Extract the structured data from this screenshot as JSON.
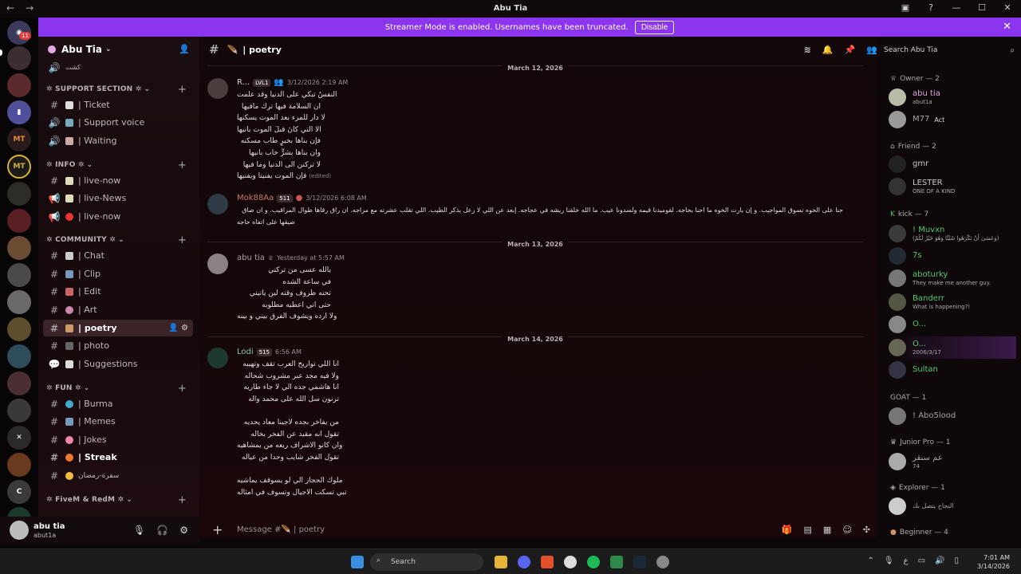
{
  "window": {
    "title": "Abu Tia",
    "back": "←",
    "forward": "→"
  },
  "banner": {
    "text": "Streamer Mode is enabled. Usernames have been truncated.",
    "button": "Disable"
  },
  "rail": {
    "badge": "11",
    "server_labels": [
      "MT",
      "C"
    ]
  },
  "guild": {
    "name": "Abu Tia"
  },
  "sidebar": {
    "top_channel": "كشت",
    "categories": [
      {
        "label": "✲ SUPPORT SECTION ✲",
        "channels": [
          "| Ticket",
          "| Support voice",
          "| Waiting"
        ]
      },
      {
        "label": "✲ INFO ✲",
        "channels": [
          "| live-now",
          "| live-News",
          "| live-now"
        ]
      },
      {
        "label": "✲ COMMUNITY ✲",
        "channels": [
          "| Chat",
          "| Clip",
          "| Edit",
          "| Art",
          "| poetry",
          "| photo",
          "| Suggestions"
        ]
      },
      {
        "label": "✲ FUN ✲",
        "channels": [
          "| Burma",
          "| Memes",
          "| Jokes",
          "| Streak",
          "سفرة-رمضان"
        ]
      },
      {
        "label": "✲ FiveM & RedM ✲",
        "channels": []
      }
    ]
  },
  "user_panel": {
    "name": "abu tia",
    "status": "abut1a"
  },
  "chat": {
    "channel": "| poetry",
    "dates": [
      "March 12, 2026",
      "March 13, 2026",
      "March 14, 2026"
    ],
    "messages": [
      {
        "author": "R...",
        "badge": "LVL1",
        "time": "3/12/2026 2:19 AM",
        "color": "#d6d0d2",
        "lines": [
          "النفسُ تبكي على الدنيا وقد علمت",
          "ان السلامة فيها ترك مافيها",
          "لا دار للمرء بعد الموت يسكنها",
          "الا التي كانَ قبلَ الموت بانيها",
          "فإن بناها بخيرٍ طاب مسكنه",
          "وان بناها بشرٍّ خاب بانيها",
          "لا تركنن الى الدنيا وما فيها",
          "فإن الموت يفنينا ويفنيها"
        ],
        "edited": "(edited)"
      },
      {
        "author": "Mok88Aa",
        "badge": "511",
        "time": "3/12/2026 6:08 AM",
        "color": "#c97b6a",
        "lines": [
          "حنا على الخوه نسوق المواجيب. و إن بارت الخوه ما احنا بحاجه. لقوميدنا قيمه ولسدونا عيب. ما الله خلقنا ريشه في عجاجه. إبعد عن اللي لا زعل يذكر الطيب. اللي تقلب عشرته مع مزاجه. ان راق رقاها طوال المراقيب. و ان ضاق",
          "ضيقها على اتفاه حاجه"
        ]
      },
      {
        "author": "abu tia",
        "badge": "",
        "time": "Yesterday at 5:57 AM",
        "color": "#a9a2a4",
        "lines": [
          "يالله عسى من تركني",
          "في ساعة الشده",
          "تحنه ظروف وقته لين ياتيني",
          "حتى اني اعطيه مطلوبه",
          "ولا ارده ويشوف الفرق بيني و بينه"
        ]
      },
      {
        "author": "Lodi",
        "badge": "515",
        "time": "6:56 AM",
        "color": "#8fc6a2",
        "lines": [
          "انا اللي تواريخ العرب تقف وتهيبه",
          "ولا فيه مجد عبر مشروب شحاله",
          "انا هاشمي جده الي لا جاء طاريه",
          "ترنون سل الله على محمد واله",
          "",
          "من يفاخر بجده لاجينا معاد يحديه",
          "تقول انه مقيد عن الفخر بخاله",
          "وان كانو الاشراف ربعه من يمشاهيه",
          "تقول الفخر شايب وحدا من عياله",
          "",
          "ملوك الحجاز الي لو يسوقف يماشيه",
          "تبي تسكت الاجيال وتسوف في امثاله"
        ]
      }
    ],
    "composer_placeholder": "Message #🪶 | poetry"
  },
  "members": {
    "search_placeholder": "Search Abu Tia",
    "groups": [
      {
        "role": "Owner — 2",
        "list": [
          {
            "name": "abu tia",
            "sub": "abut1a",
            "color": "#d9a6d9"
          },
          {
            "name": "M77",
            "sub": "Act",
            "color": "#a9a2a4"
          }
        ]
      },
      {
        "role": "Friend — 2",
        "list": [
          {
            "name": "gmr",
            "sub": "",
            "color": "#c8c8c8"
          },
          {
            "name": "LESTER",
            "sub": "ONE OF A KIND",
            "color": "#c8c8c8"
          }
        ]
      },
      {
        "role": "kick — 7",
        "list": [
          {
            "name": "! Muvxn",
            "sub": "(وَعَسَىٰ أَنْ تَكْرَهُوا شَيْئًا وَهُوَ خَيْرٌ لَكُمْ)",
            "color": "#53c96b"
          },
          {
            "name": "7s",
            "sub": "",
            "color": "#53c96b"
          },
          {
            "name": "aboturky",
            "sub": "They make me another guy.",
            "color": "#53c96b"
          },
          {
            "name": "Banderr",
            "sub": "What is happening?!",
            "color": "#53c96b"
          },
          {
            "name": "O...",
            "sub": "",
            "color": "#53c96b"
          },
          {
            "name": "O...",
            "sub": "2006/3/17",
            "color": "#53c96b"
          },
          {
            "name": "Sultan",
            "sub": "",
            "color": "#53c96b"
          }
        ]
      },
      {
        "role": "GOAT — 1",
        "list": [
          {
            "name": "! Abo5lood",
            "sub": "",
            "color": "#a9a2a4"
          }
        ]
      },
      {
        "role": "Junior Pro — 1",
        "list": [
          {
            "name": "عم سنقر",
            "sub": "74",
            "color": "#a9a2a4"
          }
        ]
      },
      {
        "role": "Explorer — 1",
        "list": [
          {
            "name": "النجاح يتصل بك",
            "sub": "",
            "color": "#a9a2a4"
          }
        ]
      },
      {
        "role": "Beginner — 4",
        "list": []
      }
    ]
  },
  "taskbar": {
    "search": "Search",
    "time": "7:01 AM",
    "date": "3/14/2026"
  },
  "icons": [
    "hash-icon",
    "speaker-icon",
    "hourglass-icon",
    "bell-icon",
    "pin-icon",
    "members-icon",
    "search-icon",
    "mic-icon",
    "headphones-icon",
    "gear-icon",
    "gift-icon",
    "gif-icon",
    "sticker-icon",
    "emoji-icon",
    "apps-icon"
  ]
}
